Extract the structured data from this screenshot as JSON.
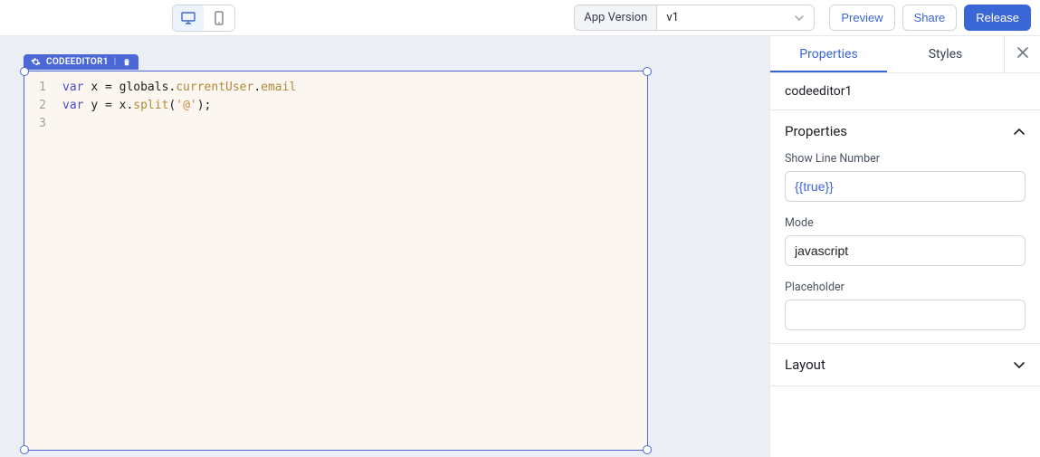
{
  "topbar": {
    "appVersionLabel": "App Version",
    "selectedVersion": "v1",
    "preview": "Preview",
    "share": "Share",
    "release": "Release"
  },
  "widget": {
    "badge": "CODEEDITOR1",
    "lines": [
      "1",
      "2",
      "3"
    ],
    "code": {
      "l1": {
        "kw": "var ",
        "ident": "x = globals",
        "dot1": ".",
        "prop1": "currentUser",
        "dot2": ".",
        "prop2": "email"
      },
      "l2": "",
      "l3": {
        "kw": "var ",
        "ident": "y = x",
        "dot": ".",
        "fn": "split",
        "paren1": "(",
        "str": "'@'",
        "paren2": ");"
      }
    }
  },
  "panel": {
    "tabs": {
      "properties": "Properties",
      "styles": "Styles"
    },
    "componentName": "codeeditor1",
    "sections": {
      "properties": {
        "title": "Properties",
        "fields": {
          "showLineNumber": {
            "label": "Show Line Number",
            "value": "{{true}}"
          },
          "mode": {
            "label": "Mode",
            "value": "javascript"
          },
          "placeholder": {
            "label": "Placeholder",
            "value": ""
          }
        }
      },
      "layout": {
        "title": "Layout"
      }
    }
  },
  "icons": {
    "desktop": "desktop-icon",
    "mobile": "mobile-icon",
    "gear": "gear-icon",
    "trash": "trash-icon",
    "close": "close-icon",
    "chevronUp": "chevron-up-icon",
    "chevronDown": "chevron-down-icon"
  }
}
